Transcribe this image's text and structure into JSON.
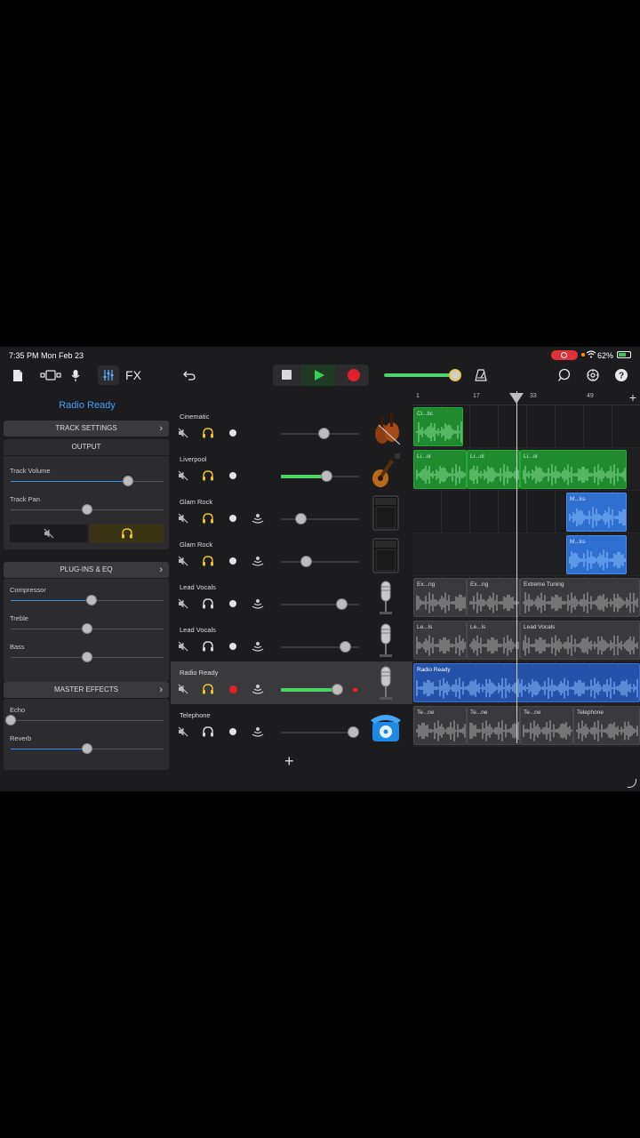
{
  "status": {
    "time": "7:35 PM  Mon Feb 23",
    "battery": "62%"
  },
  "toolbar": {
    "fx_label": "FX",
    "master_volume": 0.95
  },
  "inspector": {
    "region_title": "Radio Ready",
    "track_settings": "TRACK SETTINGS",
    "output": {
      "title": "OUTPUT",
      "track_volume_label": "Track Volume",
      "track_volume": 0.77,
      "track_pan_label": "Track Pan",
      "track_pan": 0.5
    },
    "plugins": {
      "title": "PLUG-INS & EQ",
      "compressor_label": "Compressor",
      "compressor": 0.53,
      "treble_label": "Treble",
      "treble": 0.5,
      "bass_label": "Bass",
      "bass": 0.5
    },
    "master_effects": {
      "title": "MASTER EFFECTS",
      "echo_label": "Echo",
      "echo": 0.0,
      "reverb_label": "Reverb",
      "reverb": 0.5
    }
  },
  "tracks": [
    {
      "name": "Cinematic",
      "volume": 0.55,
      "active_volume": false,
      "solo_yellow": true,
      "has_monitor": false,
      "record_armed": false,
      "instrument": "strings-icon"
    },
    {
      "name": "Liverpool",
      "volume": 0.58,
      "active_volume": true,
      "solo_yellow": true,
      "has_monitor": false,
      "record_armed": false,
      "instrument": "bass-guitar-icon"
    },
    {
      "name": "Glam Rock",
      "volume": 0.25,
      "active_volume": false,
      "solo_yellow": true,
      "has_monitor": true,
      "record_armed": false,
      "instrument": "amp-icon"
    },
    {
      "name": "Glam Rock",
      "volume": 0.32,
      "active_volume": false,
      "solo_yellow": true,
      "has_monitor": true,
      "record_armed": false,
      "instrument": "amp-icon"
    },
    {
      "name": "Lead Vocals",
      "volume": 0.77,
      "active_volume": false,
      "solo_yellow": false,
      "has_monitor": true,
      "record_armed": false,
      "instrument": "microphone-icon"
    },
    {
      "name": "Lead Vocals",
      "volume": 0.82,
      "active_volume": false,
      "solo_yellow": false,
      "has_monitor": true,
      "record_armed": false,
      "instrument": "microphone-icon"
    },
    {
      "name": "Radio Ready",
      "volume": 0.72,
      "active_volume": true,
      "solo_yellow": true,
      "has_monitor": true,
      "record_armed": true,
      "instrument": "microphone-icon"
    },
    {
      "name": "Telephone",
      "volume": 0.92,
      "active_volume": false,
      "solo_yellow": false,
      "has_monitor": true,
      "record_armed": false,
      "instrument": "telephone-icon"
    }
  ],
  "ruler": {
    "marks": [
      "1",
      "17",
      "33",
      "49"
    ]
  },
  "regions": [
    {
      "lane": 0,
      "start": 1,
      "end": 15,
      "color": "green",
      "label": "Ci...tic"
    },
    {
      "lane": 1,
      "start": 1,
      "end": 16,
      "color": "green",
      "label": "Li...ol"
    },
    {
      "lane": 1,
      "start": 16,
      "end": 31,
      "color": "green",
      "label": "Li...ol"
    },
    {
      "lane": 1,
      "start": 31,
      "end": 61,
      "color": "green",
      "label": "Li...ol"
    },
    {
      "lane": 2,
      "start": 44,
      "end": 61,
      "color": "blue",
      "label": "M...ks"
    },
    {
      "lane": 3,
      "start": 44,
      "end": 61,
      "color": "blue",
      "label": "M...ks"
    },
    {
      "lane": 4,
      "start": 1,
      "end": 16,
      "color": "gray",
      "label": "Ex...ng"
    },
    {
      "lane": 4,
      "start": 16,
      "end": 31,
      "color": "gray",
      "label": "Ex...ng"
    },
    {
      "lane": 4,
      "start": 31,
      "end": 76,
      "color": "gray",
      "label": "Extreme Tuning"
    },
    {
      "lane": 5,
      "start": 1,
      "end": 16,
      "color": "gray",
      "label": "Le...ls"
    },
    {
      "lane": 5,
      "start": 16,
      "end": 31,
      "color": "gray",
      "label": "Le...ls"
    },
    {
      "lane": 5,
      "start": 31,
      "end": 121,
      "color": "gray",
      "label": "Lead Vocals"
    },
    {
      "lane": 6,
      "start": 1,
      "end": 69,
      "color": "darkblue",
      "label": "Radio Ready"
    },
    {
      "lane": 7,
      "start": 1,
      "end": 16,
      "color": "gray",
      "label": "Te...ne"
    },
    {
      "lane": 7,
      "start": 16,
      "end": 31,
      "color": "gray",
      "label": "Te...ne"
    },
    {
      "lane": 7,
      "start": 31,
      "end": 46,
      "color": "gray",
      "label": "Te...ne"
    },
    {
      "lane": 7,
      "start": 46,
      "end": 98,
      "color": "gray",
      "label": "Telephone"
    }
  ],
  "playhead_bar": 30
}
